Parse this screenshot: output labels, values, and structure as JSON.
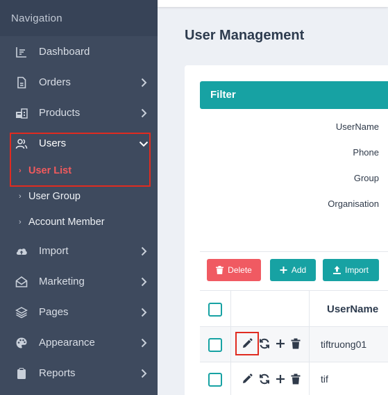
{
  "sidebar": {
    "heading": "Navigation",
    "items": [
      {
        "label": "Dashboard",
        "icon": "dashboard-icon"
      },
      {
        "label": "Orders",
        "icon": "document-icon"
      },
      {
        "label": "Products",
        "icon": "products-icon"
      },
      {
        "label": "Users",
        "icon": "users-icon",
        "expanded": true
      },
      {
        "label": "Import",
        "icon": "cloud-upload-icon"
      },
      {
        "label": "Marketing",
        "icon": "envelope-open-icon"
      },
      {
        "label": "Pages",
        "icon": "layers-icon"
      },
      {
        "label": "Appearance",
        "icon": "palette-icon"
      },
      {
        "label": "Reports",
        "icon": "clipboard-icon"
      }
    ],
    "users_sub": [
      {
        "label": "User List",
        "active": true
      },
      {
        "label": "User Group",
        "active": false
      },
      {
        "label": "Account Member",
        "active": false
      }
    ]
  },
  "page": {
    "title": "User Management",
    "filter": {
      "title": "Filter",
      "fields": [
        "UserName",
        "Phone",
        "Group",
        "Organisation"
      ]
    },
    "toolbar": {
      "delete_label": "Delete",
      "add_label": "Add",
      "import_label": "Import"
    },
    "table": {
      "header_username": "UserName",
      "rows": [
        {
          "username": "tiftruong01"
        },
        {
          "username": "tif"
        }
      ]
    }
  },
  "colors": {
    "sidebar": "#3e4a5e",
    "accent": "#17a2a3",
    "danger": "#f05a62",
    "active_link": "#f15a5d",
    "highlight": "#e02b20"
  }
}
